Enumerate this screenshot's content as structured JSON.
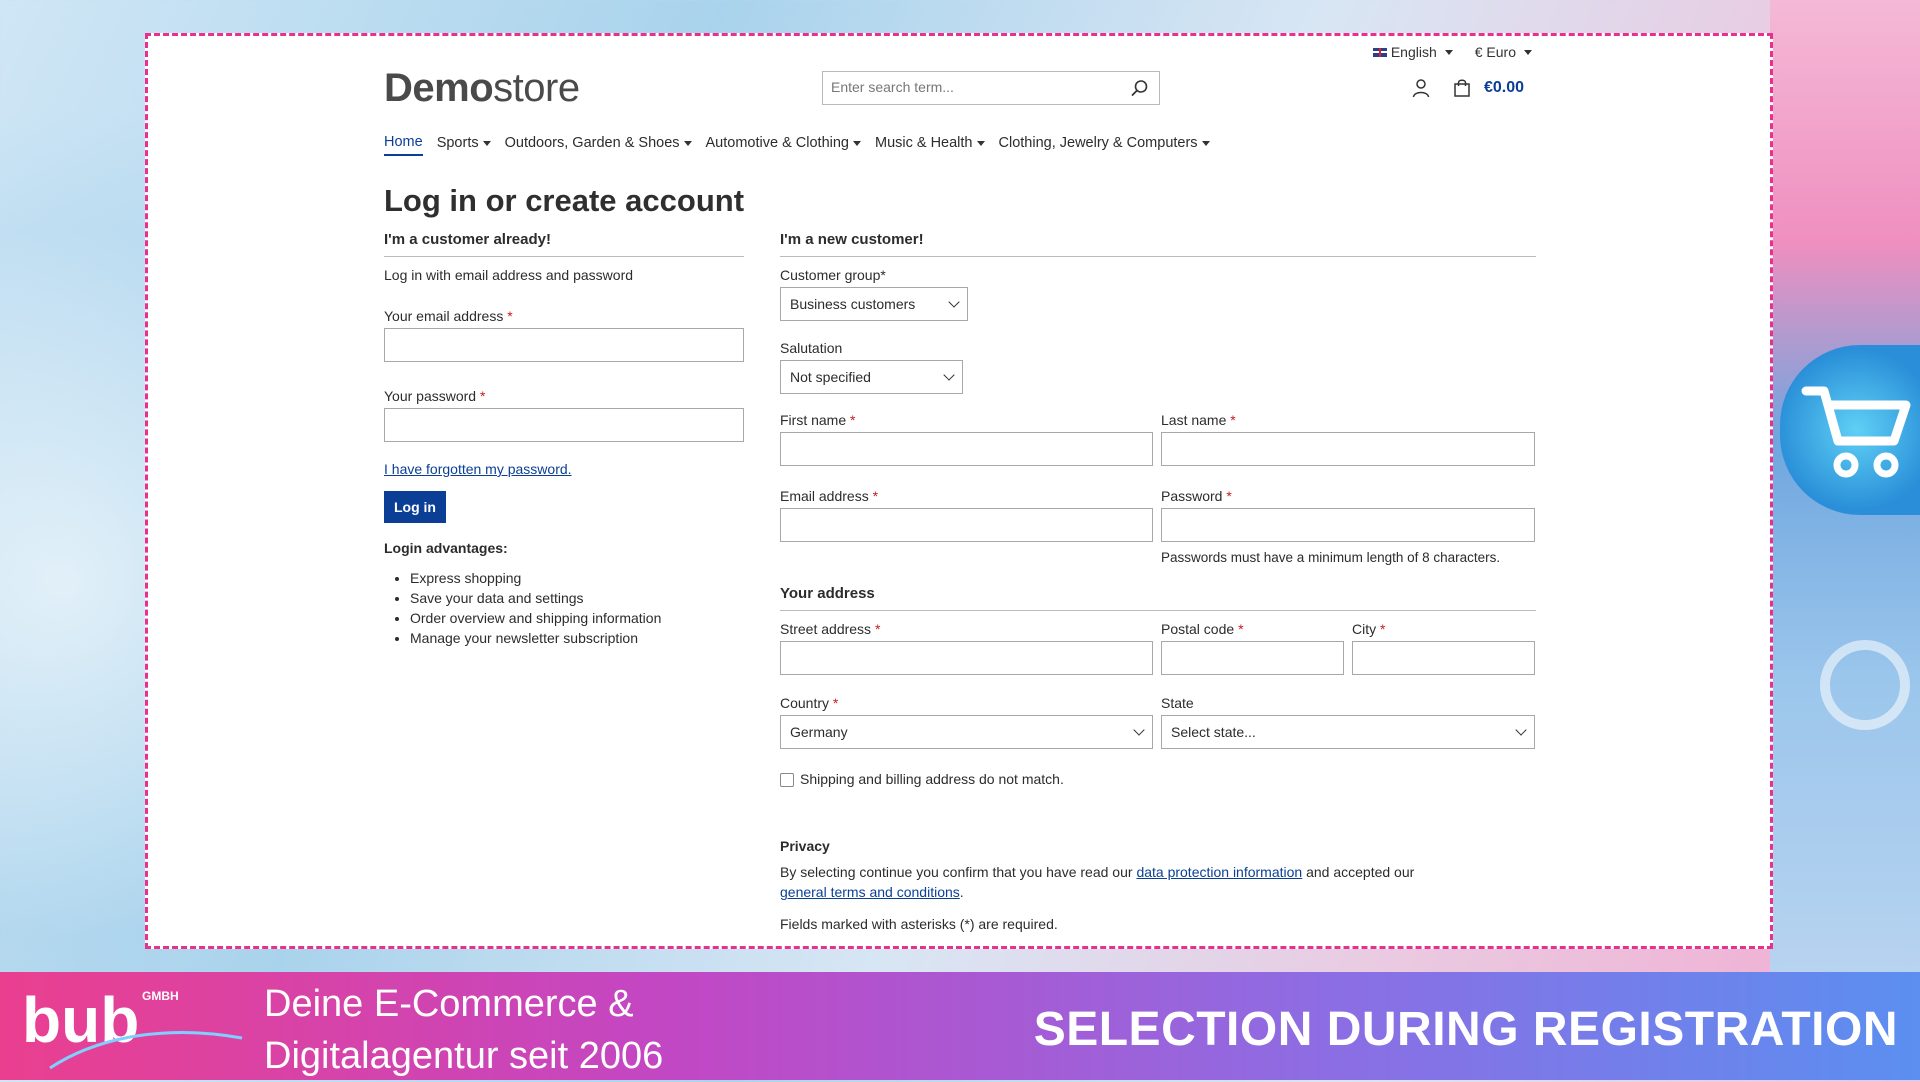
{
  "header": {
    "language": "English",
    "currency": "€ Euro",
    "logo_bold": "Demo",
    "logo_light": "store",
    "search_placeholder": "Enter search term...",
    "cart_total": "€0.00"
  },
  "nav": {
    "items": [
      {
        "label": "Home",
        "active": true,
        "has_dropdown": false
      },
      {
        "label": "Sports",
        "has_dropdown": true
      },
      {
        "label": "Outdoors, Garden & Shoes",
        "has_dropdown": true
      },
      {
        "label": "Automotive & Clothing",
        "has_dropdown": true
      },
      {
        "label": "Music & Health",
        "has_dropdown": true
      },
      {
        "label": "Clothing, Jewelry & Computers",
        "has_dropdown": true
      }
    ]
  },
  "page_title": "Log in or create account",
  "login": {
    "heading": "I'm a customer already!",
    "subtext": "Log in with email address and password",
    "email_label": "Your email address",
    "password_label": "Your password",
    "required_mark": "*",
    "forgot_link": "I have forgotten my password.",
    "login_button": "Log in",
    "advantages_heading": "Login advantages:",
    "advantages": [
      "Express shopping",
      "Save your data and settings",
      "Order overview and shipping information",
      "Manage your newsletter subscription"
    ]
  },
  "register": {
    "heading": "I'm a new customer!",
    "customer_group_label": "Customer group*",
    "customer_group_value": "Business customers",
    "salutation_label": "Salutation",
    "salutation_value": "Not specified",
    "first_name_label": "First name",
    "last_name_label": "Last name",
    "email_label": "Email address",
    "password_label": "Password",
    "password_hint": "Passwords must have a minimum length of 8 characters.",
    "address_heading": "Your address",
    "street_label": "Street address",
    "postal_label": "Postal code",
    "city_label": "City",
    "country_label": "Country",
    "country_value": "Germany",
    "state_label": "State",
    "state_value": "Select state...",
    "shipping_checkbox_label": "Shipping and billing address do not match.",
    "privacy_heading": "Privacy",
    "privacy_text_1": "By selecting continue you confirm that you have read our ",
    "privacy_link_1": "data protection information",
    "privacy_text_2": " and accepted our",
    "privacy_link_2": "general terms and conditions",
    "privacy_text_3": ".",
    "required_note": "Fields marked with asterisks (*) are required."
  },
  "banner": {
    "logo_text": "bub",
    "logo_sub": "GMBH",
    "tagline_line1": "Deine E-Commerce &",
    "tagline_line2": "Digitalagentur seit 2006",
    "title": "SELECTION DURING REGISTRATION"
  },
  "colors": {
    "primary": "#0b3f95",
    "required": "#c81b1b",
    "frame_border": "#e8318f"
  }
}
